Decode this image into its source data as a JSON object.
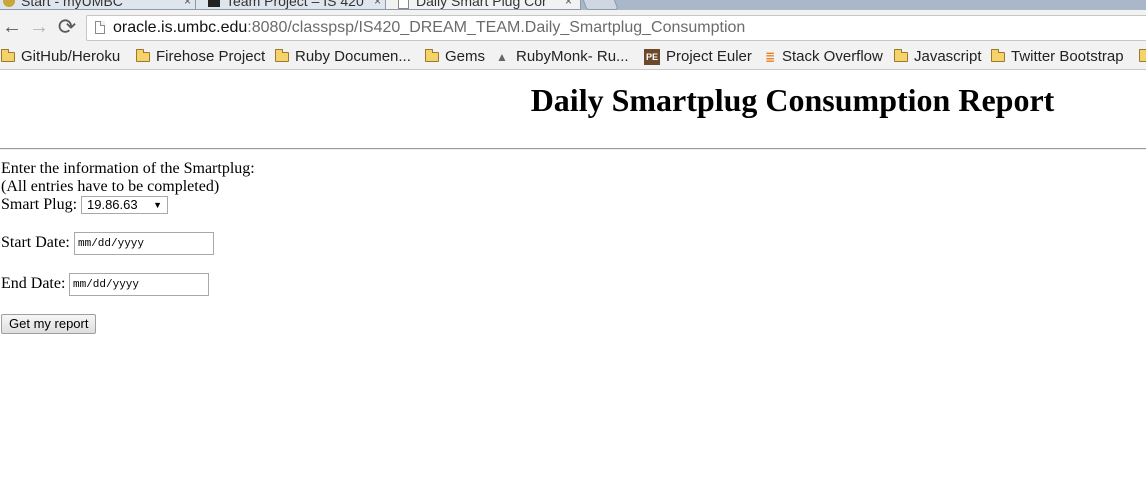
{
  "browser": {
    "tabs": [
      {
        "title": "Start - myUMBC"
      },
      {
        "title": "Team Project – IS 420"
      },
      {
        "title": "Daily Smart Plug Cor"
      }
    ],
    "tab_close_glyph": "×",
    "nav": {
      "back_glyph": "←",
      "forward_glyph": "→",
      "reload_glyph": "⟳"
    },
    "address": {
      "host": "oracle.is.umbc.edu",
      "rest": ":8080/classpsp/IS420_DREAM_TEAM.Daily_Smartplug_Consumption"
    },
    "bookmarks": [
      {
        "label": "GitHub/Heroku",
        "icon": "folder-icon"
      },
      {
        "label": "Firehose Project",
        "icon": "folder-icon"
      },
      {
        "label": "Ruby Documen...",
        "icon": "folder-icon"
      },
      {
        "label": "Gems",
        "icon": "folder-icon"
      },
      {
        "label": "RubyMonk- Ru...",
        "icon": "rubymonk-icon"
      },
      {
        "label": "Project Euler",
        "icon": "project-euler-icon"
      },
      {
        "label": "Stack Overflow",
        "icon": "stackoverflow-icon"
      },
      {
        "label": "Javascript",
        "icon": "folder-icon"
      },
      {
        "label": "Twitter Bootstrap",
        "icon": "folder-icon"
      }
    ]
  },
  "page": {
    "title": "Daily Smartplug Consumption Report",
    "intro": "Enter the information of the Smartplug:",
    "note": "(All entries have to be completed)",
    "smartplug_label": "Smart Plug:",
    "smartplug_selected": "19.86.63",
    "start_date_label": "Start Date:",
    "end_date_label": "End Date:",
    "date_placeholder": "mm/dd/yyyy",
    "submit_label": "Get my report"
  }
}
